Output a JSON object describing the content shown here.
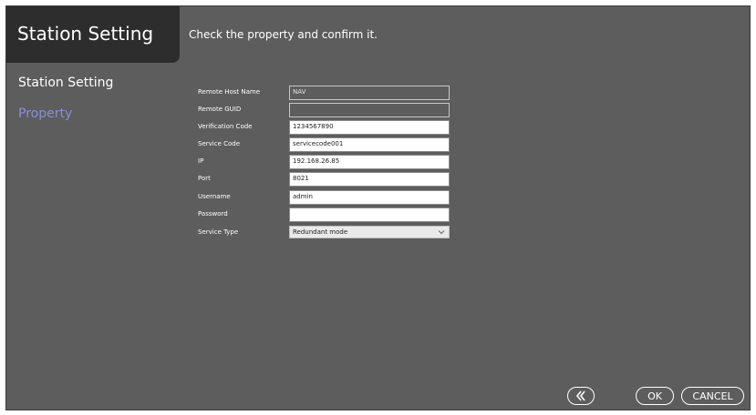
{
  "title": "Station Setting",
  "header": {
    "instruction": "Check the property and confirm it."
  },
  "sidebar": {
    "items": [
      {
        "label": "Station Setting"
      },
      {
        "label": "Property"
      }
    ]
  },
  "form": {
    "fields": [
      {
        "label": "Remote Host Name",
        "value": "NAV"
      },
      {
        "label": "Remote GUID",
        "value": ""
      },
      {
        "label": "Verification Code",
        "value": "1234567890"
      },
      {
        "label": "Service Code",
        "value": "servicecode001"
      },
      {
        "label": "IP",
        "value": "192.168.26.85"
      },
      {
        "label": "Port",
        "value": "8021"
      },
      {
        "label": "Username",
        "value": "admin"
      },
      {
        "label": "Password",
        "value": ""
      },
      {
        "label": "Service Type",
        "value": "Redundant mode"
      }
    ]
  },
  "footer": {
    "back_icon": "double-chevron-left-icon",
    "ok_label": "OK",
    "cancel_label": "CANCEL"
  },
  "colors": {
    "background": "#5d5d5d",
    "title_tab": "#2d2d2d",
    "active_sidebar_item": "#8a8fd6"
  }
}
